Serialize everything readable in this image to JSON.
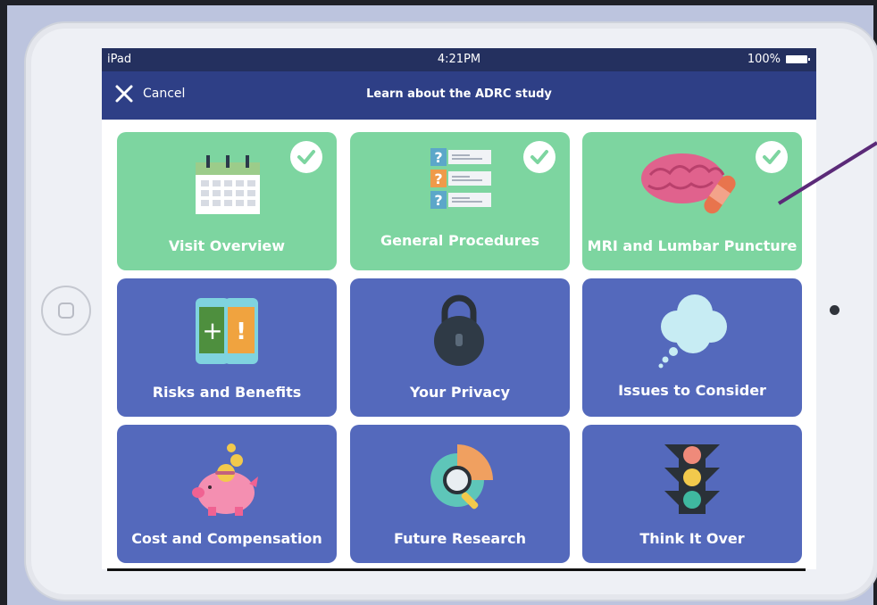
{
  "status_bar": {
    "carrier": "iPad",
    "time": "4:21PM",
    "battery": "100%"
  },
  "nav_bar": {
    "cancel_label": "Cancel",
    "title": "Learn about the ADRC study"
  },
  "tiles": [
    {
      "label": "Visit Overview",
      "completed": true,
      "icon": "calendar-icon",
      "color": "#7dd5a0"
    },
    {
      "label": "General Procedures",
      "completed": true,
      "icon": "checklist-icon",
      "color": "#7dd5a0"
    },
    {
      "label": "MRI and Lumbar Puncture",
      "completed": true,
      "icon": "brain-bandage-icon",
      "color": "#7dd5a0"
    },
    {
      "label": "Risks and Benefits",
      "completed": false,
      "icon": "phones-plus-exclamation-icon",
      "color": "#5469bc"
    },
    {
      "label": "Your Privacy",
      "completed": false,
      "icon": "padlock-icon",
      "color": "#5469bc"
    },
    {
      "label": "Issues to Consider",
      "completed": false,
      "icon": "thought-cloud-icon",
      "color": "#5469bc"
    },
    {
      "label": "Cost and Compensation",
      "completed": false,
      "icon": "piggy-bank-icon",
      "color": "#5469bc"
    },
    {
      "label": "Future Research",
      "completed": false,
      "icon": "magnifier-chart-icon",
      "color": "#5469bc"
    },
    {
      "label": "Think It Over",
      "completed": false,
      "icon": "traffic-light-icon",
      "color": "#5469bc"
    }
  ],
  "colors": {
    "status_bar": "#24305f",
    "nav_bar": "#2e3f86",
    "tile_completed": "#7dd5a0",
    "tile_pending": "#5469bc",
    "annotation_line": "#5b2a78"
  }
}
